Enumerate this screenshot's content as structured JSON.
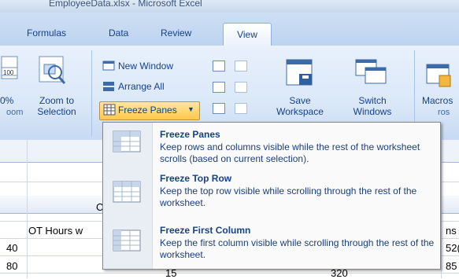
{
  "window": {
    "title": "EmployeeData.xlsx - Microsoft Excel"
  },
  "ribbon": {
    "tabs": [
      "Formulas",
      "Data",
      "Review"
    ],
    "active_tab": "View",
    "zoom_group": {
      "partial_percent": "0%",
      "zoom_to_selection": "Zoom to Selection",
      "group_label_partial": "oom"
    },
    "window_group": {
      "new_window": "New Window",
      "arrange_all": "Arrange All",
      "freeze_panes": "Freeze Panes",
      "save_workspace": "Save Workspace",
      "switch_windows": "Switch Windows"
    },
    "macros_group": {
      "macros": "Macros",
      "group_label_partial": "ros"
    }
  },
  "sheet": {
    "partial_col_letter": "C",
    "header_row": {
      "ot_hours": "OT Hours w",
      "right_partial": "ns"
    },
    "rows": [
      {
        "a": "40",
        "right": "52("
      },
      {
        "a": "80",
        "mid": "15",
        "mid2": "320",
        "right": "85"
      }
    ]
  },
  "freeze_menu": {
    "items": [
      {
        "title": "Freeze Panes",
        "desc": "Keep rows and columns visible while the rest of the worksheet scrolls (based on current selection)."
      },
      {
        "title": "Freeze Top Row",
        "desc": "Keep the top row visible while scrolling through the rest of the worksheet."
      },
      {
        "title": "Freeze First Column",
        "desc": "Keep the first column visible while scrolling through the rest of the worksheet."
      }
    ]
  },
  "colors": {
    "accent": "#15428b",
    "active_button": "#ffc84a"
  }
}
